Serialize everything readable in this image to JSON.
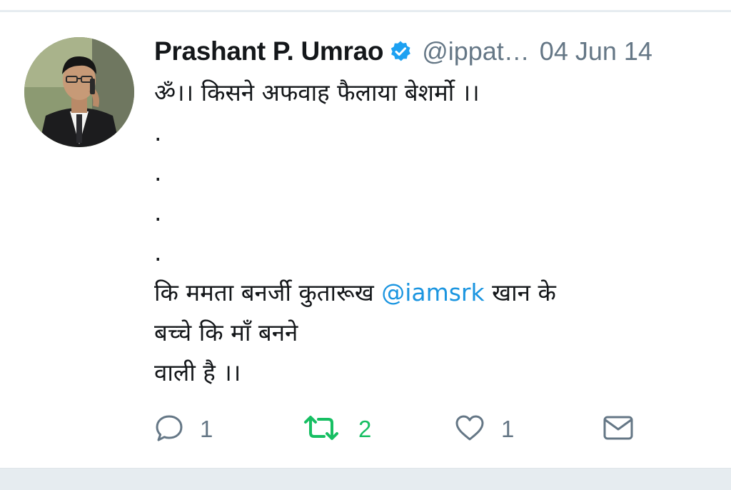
{
  "tweet": {
    "display_name": "Prashant P. Umrao",
    "handle": "@ippat…",
    "timestamp": "04 Jun 14",
    "verified": true,
    "lines": [
      "ॐ।। किसने अफवाह फैलाया बेशर्मो ।।",
      ".",
      ".",
      ".",
      "."
    ],
    "line_mention_pre": "कि ममता बनर्जी कुतारूख ",
    "mention": "@iamsrk",
    "line_mention_post": "  खान के",
    "line_7": "बच्चे कि माँ बनने",
    "line_8": "वाली है ।।"
  },
  "actions": {
    "reply": {
      "icon": "reply-icon",
      "count": "1"
    },
    "retweet": {
      "icon": "retweet-icon",
      "count": "2"
    },
    "like": {
      "icon": "heart-icon",
      "count": "1"
    },
    "message": {
      "icon": "envelope-icon"
    }
  },
  "colors": {
    "text": "#14171a",
    "secondary": "#657786",
    "link": "#1b95e0",
    "verified": "#1da1f2",
    "retweet_active": "#17bf63"
  }
}
